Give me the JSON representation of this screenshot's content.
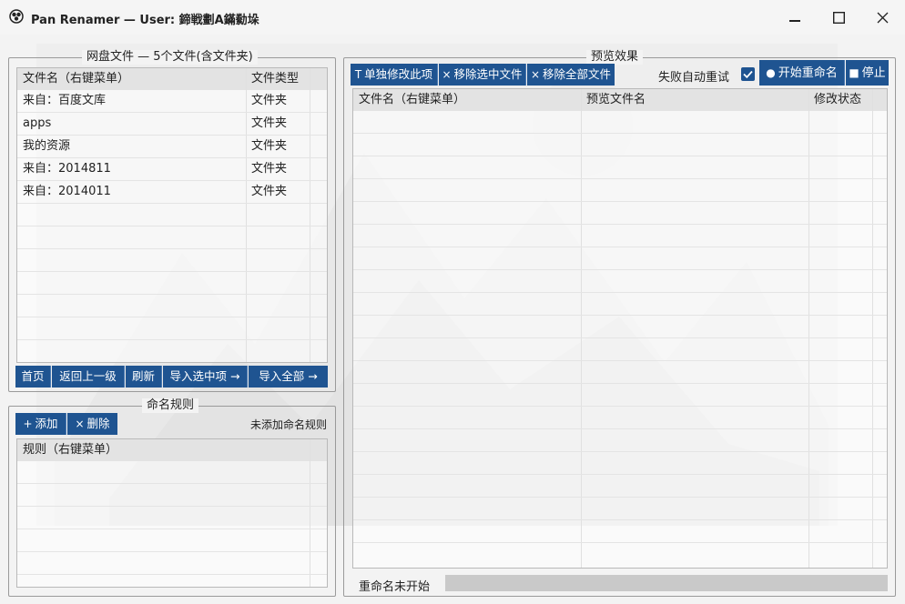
{
  "window": {
    "title": "Pan Renamer — User:  鍗戦劃A鏋勬垛",
    "icons": {
      "app": "app-logo-icon",
      "minimize": "minimize-icon",
      "maximize": "maximize-icon",
      "close": "close-icon"
    }
  },
  "netdisk": {
    "group_title": "网盘文件 — 5个文件(含文件夹)",
    "columns": [
      "文件名（右键菜单）",
      "文件类型"
    ],
    "rows": [
      {
        "name": "来自：百度文库",
        "type": "文件夹"
      },
      {
        "name": "apps",
        "type": "文件夹"
      },
      {
        "name": "我的资源",
        "type": "文件夹"
      },
      {
        "name": "来自：2014811",
        "type": "文件夹"
      },
      {
        "name": "来自：2014011",
        "type": "文件夹"
      }
    ],
    "buttons": {
      "home": "首页",
      "back": "返回上一级",
      "refresh": "刷新",
      "import_selected": "导入选中项 →",
      "import_all": "导入全部 →"
    }
  },
  "rules": {
    "group_title": "命名规则",
    "add_label": "添加",
    "delete_label": "删除",
    "status": "未添加命名规则",
    "column": "规则（右键菜单）"
  },
  "preview": {
    "group_title": "预览效果",
    "buttons": {
      "edit_single": "单独修改此项",
      "remove_selected": "移除选中文件",
      "remove_all": "移除全部文件",
      "start": "开始重命名",
      "stop": "停止"
    },
    "retry_label": "失败自动重试",
    "retry_checked": true,
    "columns": [
      "文件名（右键菜单）",
      "预览文件名",
      "修改状态"
    ],
    "status_text": "重命名未开始",
    "progress": 0
  },
  "colors": {
    "accent": "#1f5491",
    "header_bg": "#e3e3e3"
  }
}
